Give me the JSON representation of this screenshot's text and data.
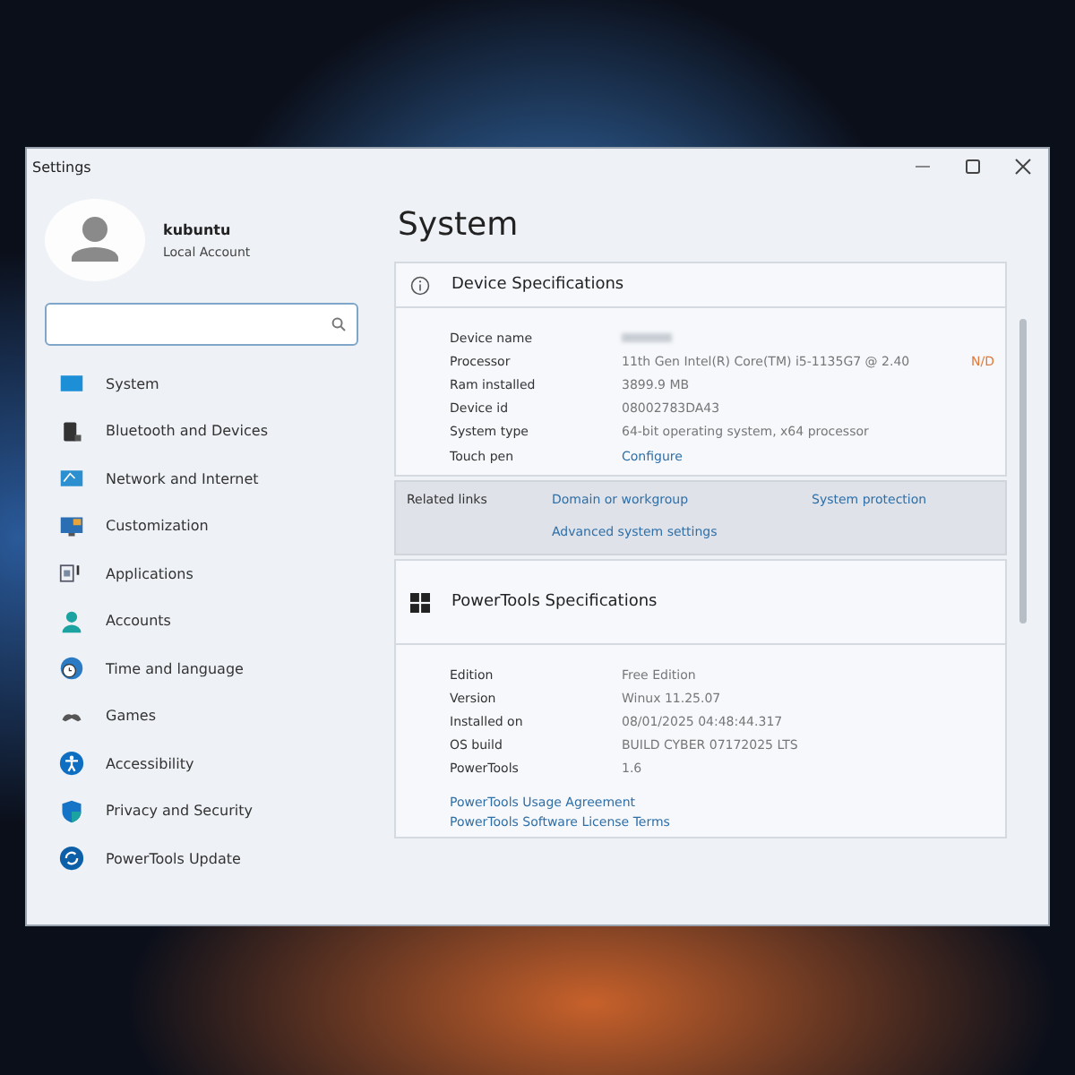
{
  "window": {
    "title": "Settings"
  },
  "account": {
    "name": "kubuntu",
    "type": "Local Account"
  },
  "sidebar": {
    "items": [
      {
        "label": "System",
        "kind": "display"
      },
      {
        "label": "Bluetooth and Devices",
        "kind": "devices"
      },
      {
        "label": "Network and Internet",
        "kind": "network"
      },
      {
        "label": "Customization",
        "kind": "customize"
      },
      {
        "label": "Applications",
        "kind": "apps"
      },
      {
        "label": "Accounts",
        "kind": "person"
      },
      {
        "label": "Time and language",
        "kind": "clock"
      },
      {
        "label": "Games",
        "kind": "gamepad"
      },
      {
        "label": "Accessibility",
        "kind": "access"
      },
      {
        "label": "Privacy and Security",
        "kind": "shield"
      },
      {
        "label": "PowerTools Update",
        "kind": "update"
      }
    ]
  },
  "page": {
    "title": "System"
  },
  "device_specs": {
    "title": "Device Specifications",
    "rows": [
      {
        "label": "Device name",
        "value": "",
        "kind": "blurred"
      },
      {
        "label": "Processor",
        "value": "11th Gen Intel(R) Core(TM) i5-1135G7 @ 2.40",
        "kind": "text",
        "note": "N/D"
      },
      {
        "label": "Ram installed",
        "value": "3899.9 MB",
        "kind": "text"
      },
      {
        "label": "Device id",
        "value": "08002783DA43",
        "kind": "text"
      },
      {
        "label": "System type",
        "value": "64-bit operating system, x64 processor",
        "kind": "text"
      },
      {
        "label": "Touch pen",
        "value": "Configure",
        "kind": "link"
      }
    ]
  },
  "related_links": {
    "label": "Related links",
    "links": [
      "Domain or workgroup",
      "System protection",
      "Advanced system settings"
    ]
  },
  "powertools_specs": {
    "title": "PowerTools Specifications",
    "rows": [
      {
        "label": "Edition",
        "value": "Free Edition"
      },
      {
        "label": "Version",
        "value": "Winux 11.25.07"
      },
      {
        "label": "Installed on",
        "value": "08/01/2025 04:48:44.317"
      },
      {
        "label": "OS build",
        "value": "BUILD CYBER 07172025 LTS"
      },
      {
        "label": "PowerTools",
        "value": "1.6"
      }
    ],
    "links": [
      "PowerTools Usage Agreement",
      "PowerTools Software License Terms"
    ]
  }
}
